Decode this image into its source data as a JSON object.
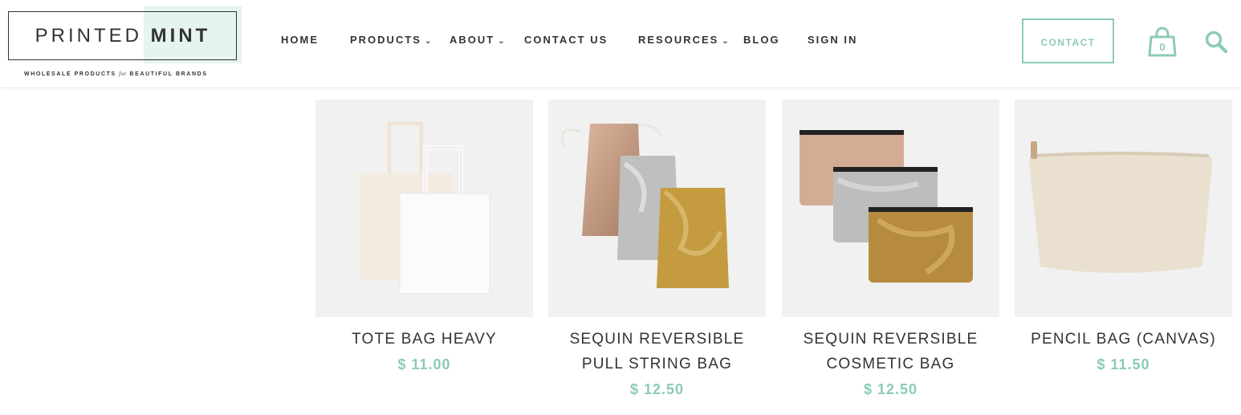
{
  "brand": {
    "name_part1": "PRINTED",
    "name_part2": "MINT",
    "tagline_part1": "WHOLESALE PRODUCTS ",
    "tagline_italic": "for",
    "tagline_part2": " BEAUTIFUL BRANDS"
  },
  "nav": {
    "items": [
      {
        "label": "HOME",
        "dropdown": false
      },
      {
        "label": "PRODUCTS",
        "dropdown": true
      },
      {
        "label": "ABOUT",
        "dropdown": true
      },
      {
        "label": "CONTACT US",
        "dropdown": false
      },
      {
        "label": "RESOURCES",
        "dropdown": true
      },
      {
        "label": "BLOG",
        "dropdown": false
      },
      {
        "label": "SIGN IN",
        "dropdown": false
      }
    ]
  },
  "header": {
    "contact_label": "CONTACT",
    "cart_count": "0",
    "icons": {
      "cart": "shopping-bag-icon",
      "search": "search-icon",
      "dropdown": "chevron-down-icon"
    }
  },
  "colors": {
    "accent": "#8ccbb5",
    "mint_bg": "#e5f4ee",
    "text": "#333333",
    "tile_bg": "#f1f1f1"
  },
  "products": [
    {
      "name_line1": "TOTE BAG HEAVY",
      "name_line2": "",
      "price": "$ 11.00"
    },
    {
      "name_line1": "SEQUIN REVERSIBLE",
      "name_line2": "PULL STRING BAG",
      "price": "$ 12.50"
    },
    {
      "name_line1": "SEQUIN REVERSIBLE",
      "name_line2": "COSMETIC BAG",
      "price": "$ 12.50"
    },
    {
      "name_line1": "PENCIL BAG (CANVAS)",
      "name_line2": "",
      "price": "$ 11.50"
    }
  ]
}
